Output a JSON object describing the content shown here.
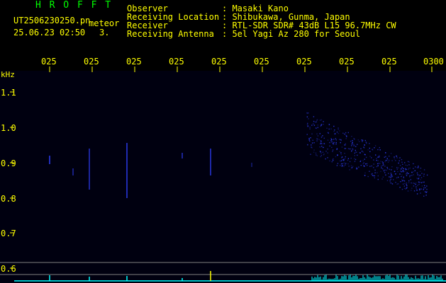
{
  "header": {
    "program": "H R O F F T",
    "filename": "UT2506230250.pn",
    "mode": "meteor",
    "datetime": "25.06.23 02:50",
    "count": "3.",
    "fields": [
      {
        "label": "Observer",
        "value": ": Masaki Kano"
      },
      {
        "label": "Receiving Location",
        "value": ": Shibukawa, Gunma, Japan"
      },
      {
        "label": "Receiver",
        "value": ": RTL-SDR SDR# 43dB L15 96.7MHz CW"
      },
      {
        "label": "Receiving Antenna",
        "value": ": 5el Yagi Az 280 for Seoul"
      }
    ]
  },
  "axis": {
    "unit": "kHz",
    "time_ticks": [
      "025",
      "025",
      "025",
      "025",
      "025",
      "025",
      "025",
      "025",
      "025",
      "0300"
    ],
    "freq_ticks": [
      "1.1",
      "1.0",
      "0.9",
      "0.8",
      "0.7",
      "0.6"
    ]
  },
  "colors": {
    "label": "#ffff00",
    "title": "#00ff00",
    "background": "#000010",
    "signal": "#3040ff",
    "baseline": "#00ffff"
  }
}
